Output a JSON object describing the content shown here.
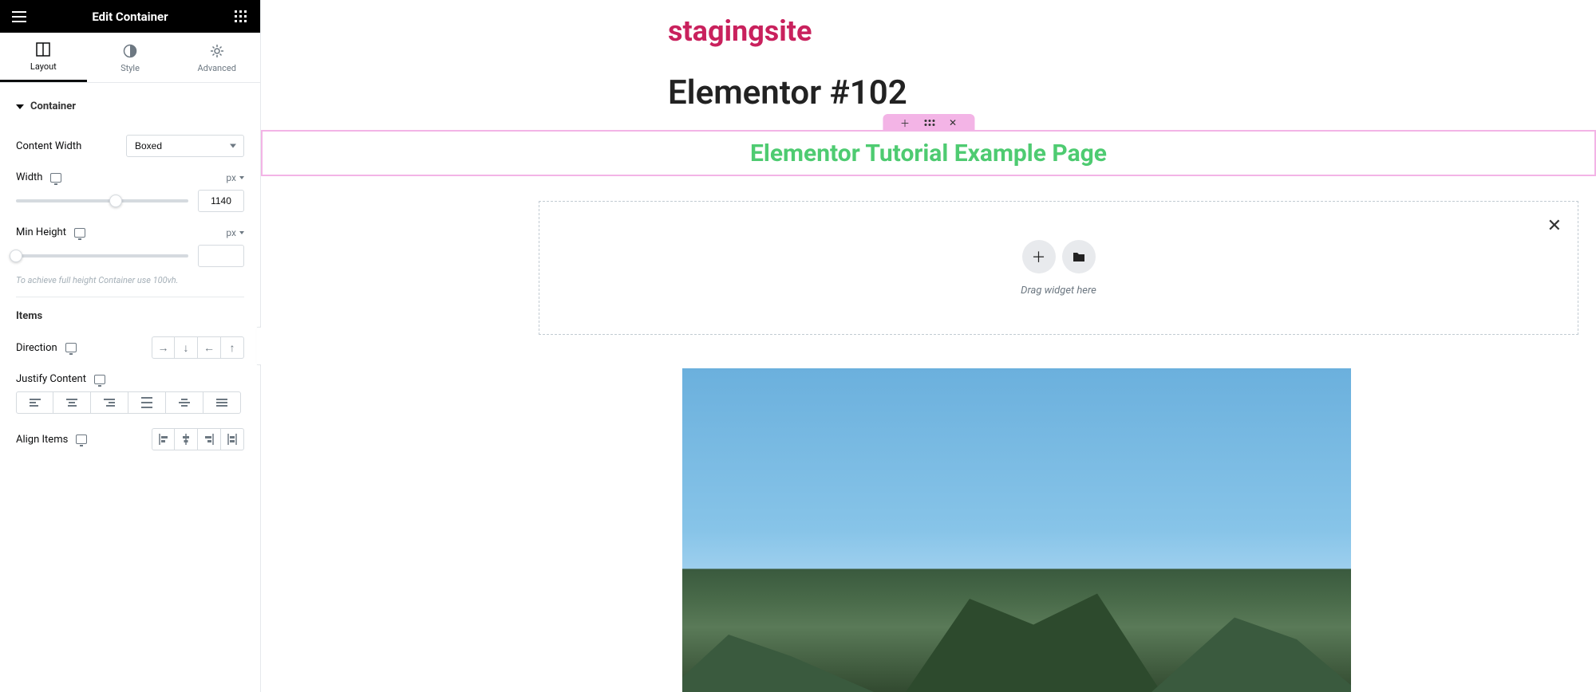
{
  "sidebar": {
    "title": "Edit Container",
    "tabs": {
      "layout": "Layout",
      "style": "Style",
      "advanced": "Advanced"
    },
    "section_label": "Container",
    "content_width": {
      "label": "Content Width",
      "value": "Boxed"
    },
    "width": {
      "label": "Width",
      "unit": "px",
      "value": "1140",
      "percent": 58
    },
    "min_height": {
      "label": "Min Height",
      "unit": "px",
      "value": "",
      "percent": 0
    },
    "help_text": "To achieve full height Container use 100vh.",
    "items_label": "Items",
    "direction_label": "Direction",
    "justify_label": "Justify Content",
    "align_label": "Align Items"
  },
  "canvas": {
    "site_title": "stagingsite",
    "page_title": "Elementor #102",
    "selected_heading": "Elementor Tutorial Example Page",
    "drop_text": "Drag widget here"
  }
}
